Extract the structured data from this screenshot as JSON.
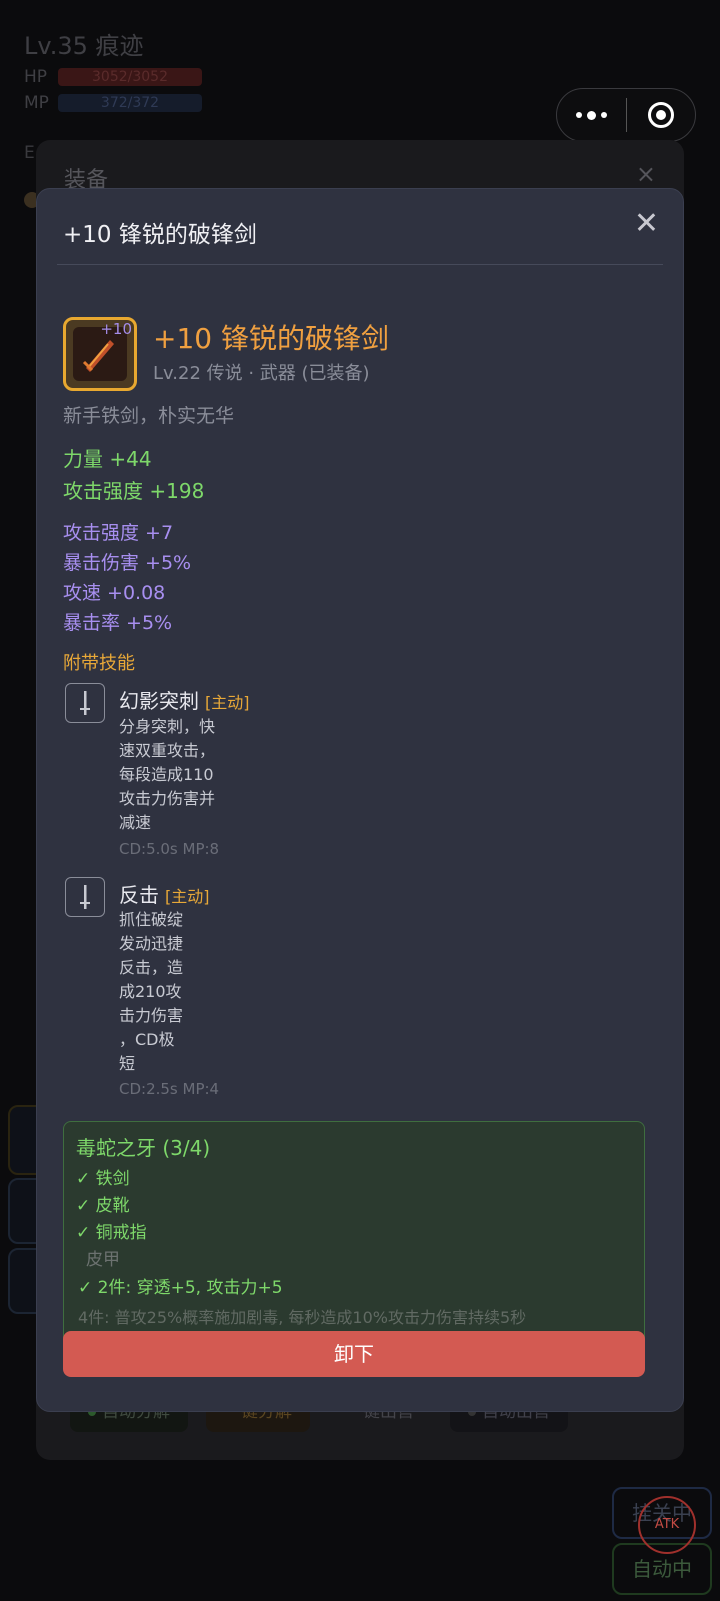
{
  "background": {
    "player_title": "Lv.35 痕迹",
    "hp_label": "HP",
    "hp_value": "3052/3052",
    "mp_label": "MP",
    "mp_value": "372/372",
    "e_label": "E"
  },
  "equip_panel": {
    "title": "装备",
    "close_icon": "×",
    "actions": [
      "自动分解",
      "一键分解",
      "一键出售",
      "自动出售"
    ]
  },
  "side_buttons": [
    "挂关中",
    "自动中"
  ],
  "atk_label": "ATK",
  "dialog": {
    "title": "+10 锋锐的破锋剑",
    "close_icon": "✕",
    "item": {
      "enhance": "+10",
      "name": "+10 锋锐的破锋剑",
      "meta": "Lv.22 传说 · 武器 (已装备)",
      "desc": "新手铁剑，朴实无华"
    },
    "base_stats": [
      "力量 +44",
      "攻击强度 +198"
    ],
    "extra_stats": [
      "攻击强度 +7",
      "暴击伤害 +5%",
      "攻速 +0.08",
      "暴击率 +5%"
    ],
    "skills_title": "附带技能",
    "skills": [
      {
        "name": "幻影突刺",
        "tag": "[主动]",
        "desc": "分身突刺，快\n速双重攻击，\n每段造成110\n攻击力伤害并\n减速",
        "cd": "CD:5.0s  MP:8"
      },
      {
        "name": "反击",
        "tag": "[主动]",
        "desc": "抓住破绽\n发动迅捷\n反击，造\n成210攻\n击力伤害\n，CD极\n短",
        "cd": "CD:2.5s  MP:4"
      }
    ],
    "set": {
      "title": "毒蛇之牙 (3/4)",
      "owned": [
        "✓ 铁剑",
        "✓ 皮靴",
        "✓ 铜戒指"
      ],
      "missing": "皮甲",
      "bonus_active": "✓ 2件: 穿透+5, 攻击力+5",
      "bonus_inactive": "4件: 普攻25%概率施加剧毒, 每秒造成10%攻击力伤害持续5秒"
    },
    "unequip_label": "卸下"
  }
}
